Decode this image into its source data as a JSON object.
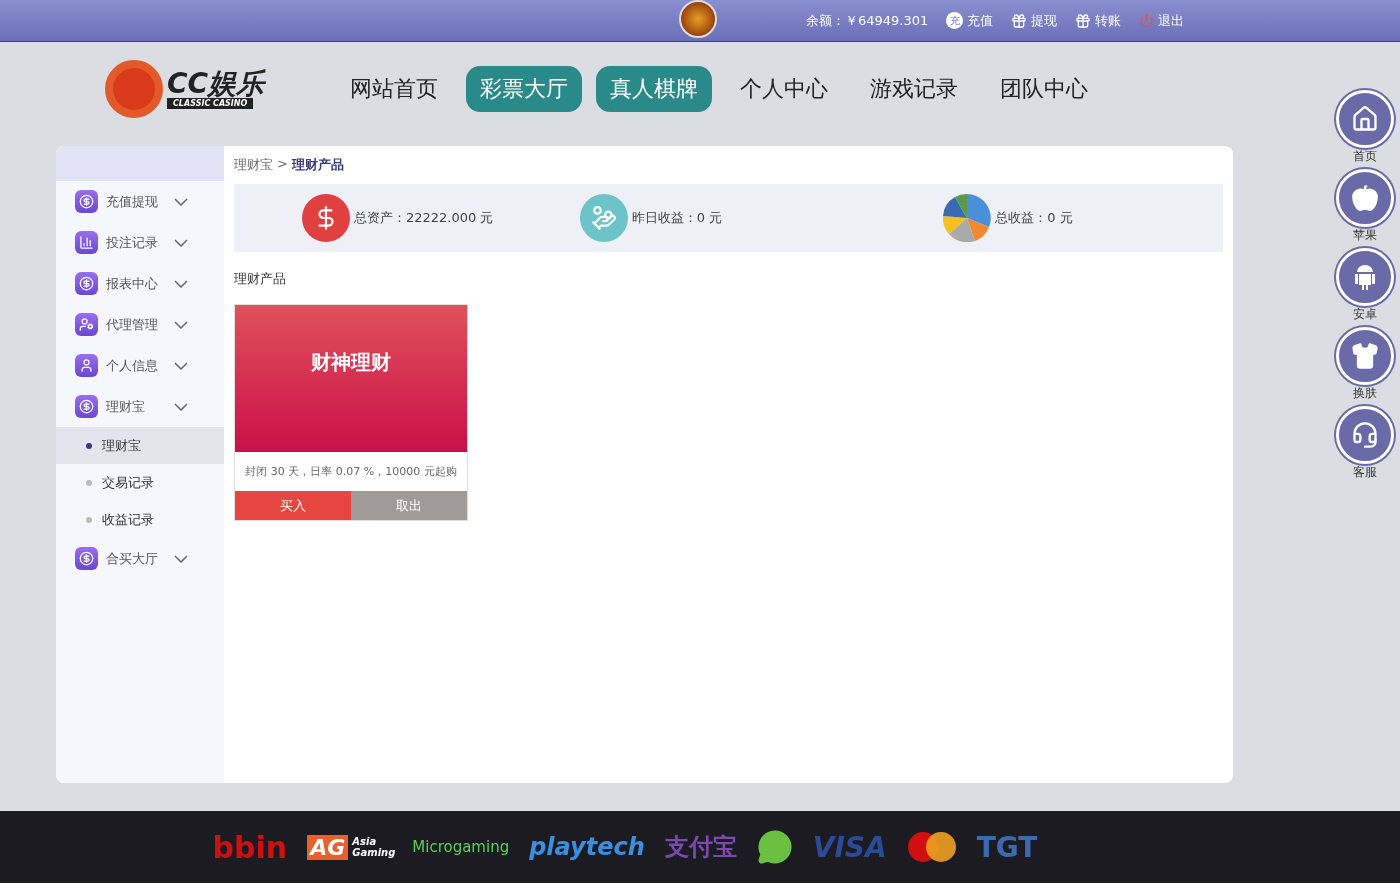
{
  "topbar": {
    "balance": "余额：￥64949.301",
    "links": [
      {
        "kind": "recharge",
        "badge": "充",
        "label": "充值"
      },
      {
        "kind": "withdraw",
        "label": "提现"
      },
      {
        "kind": "transfer",
        "label": "转账"
      },
      {
        "kind": "logout",
        "label": "退出"
      }
    ]
  },
  "header": {
    "logo_title": "CC娱乐",
    "logo_subtitle": "CLASSIC CASINO",
    "nav": [
      {
        "label": "网站首页",
        "highlighted": false
      },
      {
        "label": "彩票大厅",
        "highlighted": true
      },
      {
        "label": "真人棋牌",
        "highlighted": true
      },
      {
        "label": "个人中心",
        "highlighted": false
      },
      {
        "label": "游戏记录",
        "highlighted": false
      },
      {
        "label": "团队中心",
        "highlighted": false
      }
    ]
  },
  "sidebar": {
    "groups": [
      {
        "kind": "yuan-plus",
        "label": "充值提现"
      },
      {
        "kind": "chart",
        "label": "投注记录"
      },
      {
        "kind": "coin",
        "label": "报表中心"
      },
      {
        "kind": "user-gear",
        "label": "代理管理"
      },
      {
        "kind": "user",
        "label": "个人信息"
      },
      {
        "kind": "coin",
        "label": "理财宝",
        "children": [
          {
            "label": "理财宝",
            "selected": true
          },
          {
            "label": "交易记录",
            "selected": false
          },
          {
            "label": "收益记录",
            "selected": false
          }
        ]
      },
      {
        "kind": "coin",
        "label": "合买大厅"
      }
    ]
  },
  "breadcrumb": {
    "parent": "理财宝",
    "separator": ">",
    "current": "理财产品"
  },
  "stats": [
    {
      "kind": "dollar",
      "label": "总资产：22222.000 元"
    },
    {
      "kind": "hand",
      "label": "昨日收益：0 元"
    },
    {
      "kind": "pie",
      "label": "总收益：0 元"
    }
  ],
  "section_title": "理财产品",
  "products": [
    {
      "title": "财神理财",
      "description": "封闭 30 天，日率 0.07 %，10000 元起购",
      "buttons": [
        {
          "kind": "buy",
          "label": "买入"
        },
        {
          "kind": "withdraw",
          "label": "取出"
        }
      ]
    }
  ],
  "side_buttons": [
    {
      "kind": "home",
      "label": "首页"
    },
    {
      "kind": "apple",
      "label": "苹果"
    },
    {
      "kind": "android",
      "label": "安卓"
    },
    {
      "kind": "shirt",
      "label": "换肤"
    },
    {
      "kind": "support",
      "label": "客服"
    }
  ],
  "footer_logos": [
    {
      "kind": "bbin",
      "text": "bbin"
    },
    {
      "kind": "ag",
      "text": "AG",
      "sub": "Asia Gaming"
    },
    {
      "kind": "micro",
      "text": "Microgaming"
    },
    {
      "kind": "playtech",
      "text": "playtech"
    },
    {
      "kind": "alipay",
      "text": "支付宝"
    },
    {
      "kind": "wechat"
    },
    {
      "kind": "visa",
      "text": "VISA"
    },
    {
      "kind": "mastercard"
    },
    {
      "kind": "tgt",
      "text": "TGT"
    }
  ]
}
